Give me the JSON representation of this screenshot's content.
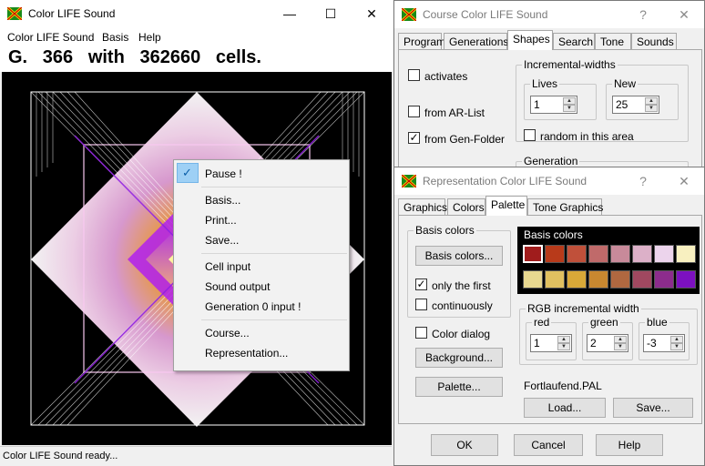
{
  "main_window": {
    "title": "Color LIFE Sound",
    "menu": [
      "Color LIFE Sound",
      "Basis",
      "Help"
    ],
    "generation_text": "G.   366   with   362660   cells.",
    "status": "Color LIFE Sound ready...",
    "controls": {
      "minimize": "—",
      "maximize": "☐",
      "close": "✕"
    }
  },
  "context_menu": {
    "items": [
      {
        "label": "Pause !",
        "checked": true
      },
      {
        "label": "Basis..."
      },
      {
        "label": "Print..."
      },
      {
        "label": "Save..."
      },
      {
        "label": "Cell input"
      },
      {
        "label": "Sound output"
      },
      {
        "label": "Generation 0 input !"
      },
      {
        "label": "Course..."
      },
      {
        "label": "Representation..."
      }
    ]
  },
  "course_window": {
    "title": "Course Color LIFE Sound",
    "help": "?",
    "close": "✕",
    "tabs": [
      "Program",
      "Generations",
      "Shapes",
      "Search",
      "Tone",
      "Sounds"
    ],
    "selected_tab": "Shapes",
    "activates_label": "activates",
    "from_ar_list_label": "from AR-List",
    "from_gen_folder_label": "from Gen-Folder",
    "incremental_widths_label": "Incremental-widths",
    "lives_label": "Lives",
    "lives_value": "1",
    "new_label": "New",
    "new_value": "25",
    "random_label": "random in this area",
    "generation_label": "Generation"
  },
  "representation_window": {
    "title": "Representation Color LIFE Sound",
    "help": "?",
    "close": "✕",
    "tabs": [
      "Graphics",
      "Colors",
      "Palette",
      "Tone Graphics"
    ],
    "selected_tab": "Palette",
    "basis_colors_group": "Basis colors",
    "basis_colors_button": "Basis colors...",
    "only_first_label": "only the first",
    "continuously_label": "continuously",
    "color_dialog_label": "Color dialog",
    "background_button": "Background...",
    "palette_button": "Palette...",
    "swatch_panel_label": "Basis colors",
    "swatch_colors": [
      "#a01c1c",
      "#b83a1a",
      "#c0503a",
      "#c06a6a",
      "#c88a9a",
      "#dcb0c8",
      "#ecd4ec",
      "#f8f0c0",
      "#e8d890",
      "#e0c060",
      "#d8a838",
      "#c88830",
      "#b06840",
      "#a04860",
      "#8c2c8c",
      "#7c10c0"
    ],
    "rgb_group": "RGB incremental width",
    "red_label": "red",
    "red_value": "1",
    "green_label": "green",
    "green_value": "2",
    "blue_label": "blue",
    "blue_value": "-3",
    "palette_file": "Fortlaufend.PAL",
    "load_button": "Load...",
    "save_button": "Save...",
    "ok_button": "OK",
    "cancel_button": "Cancel",
    "help_button": "Help"
  }
}
